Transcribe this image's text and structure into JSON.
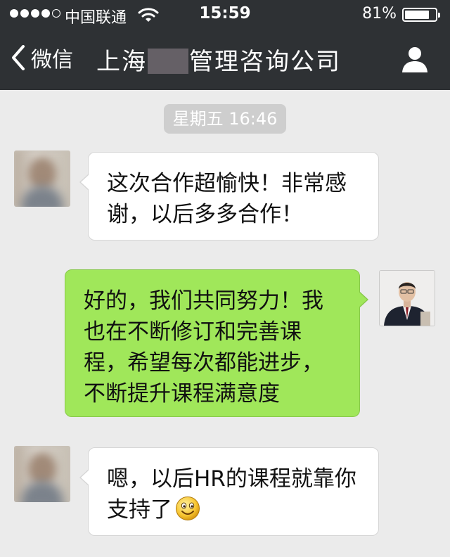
{
  "status_bar": {
    "carrier": "中国联通",
    "time": "15:59",
    "battery_percent": "81%",
    "battery_level": 0.81,
    "signal_bars": 4
  },
  "nav": {
    "back_label": "微信",
    "title_prefix": "上海",
    "title_suffix": "管理咨询公司",
    "back_icon": "chevron-left-icon",
    "profile_icon": "person-icon"
  },
  "chat": {
    "timestamp": "星期五 16:46",
    "messages": [
      {
        "from": "other",
        "text": "这次合作超愉快！非常感谢，以后多多合作！"
      },
      {
        "from": "me",
        "text": "好的，我们共同努力！我也在不断修订和完善课程，希望每次都能进步，不断提升课程满意度"
      },
      {
        "from": "other",
        "text": "嗯，以后HR的课程就靠你支持了",
        "emoji": "smile-emoji"
      }
    ]
  },
  "colors": {
    "header_bg": "#2e3134",
    "chat_bg": "#ebebeb",
    "outgoing_bubble": "#a0e75a",
    "incoming_bubble": "#ffffff",
    "timestamp_pill": "#cecece"
  }
}
